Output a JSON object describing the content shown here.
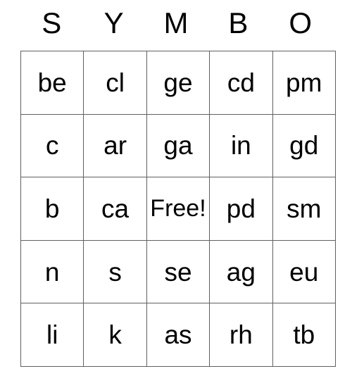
{
  "card": {
    "title_letters": [
      "S",
      "Y",
      "M",
      "B",
      "O"
    ],
    "free_space_label": "Free!",
    "border_color": "#606060",
    "text_color": "#000000",
    "background_color": "#ffffff",
    "rows": [
      [
        "be",
        "cl",
        "ge",
        "cd",
        "pm"
      ],
      [
        "c",
        "ar",
        "ga",
        "in",
        "gd"
      ],
      [
        "b",
        "ca",
        "Free!",
        "pd",
        "sm"
      ],
      [
        "n",
        "s",
        "se",
        "ag",
        "eu"
      ],
      [
        "li",
        "k",
        "as",
        "rh",
        "tb"
      ]
    ]
  }
}
